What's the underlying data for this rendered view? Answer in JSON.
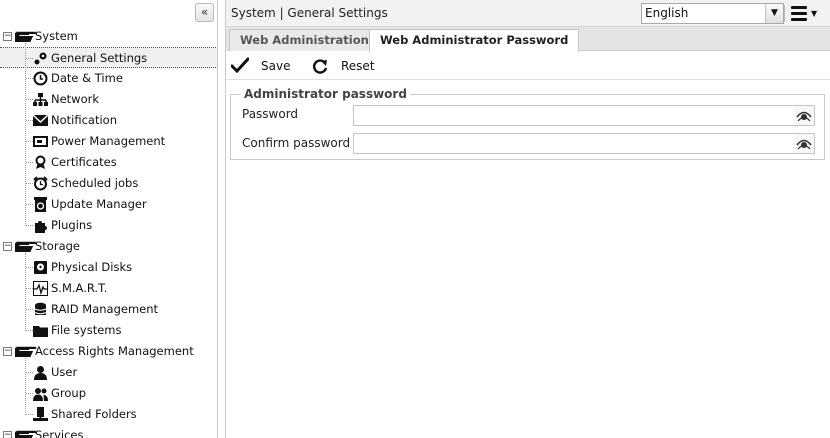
{
  "nav": {
    "collapse_glyph": "«",
    "groups": [
      {
        "label": "System",
        "expanded": true,
        "children": [
          {
            "label": "General Settings",
            "icon": "gear-icon",
            "selected": true
          },
          {
            "label": "Date & Time",
            "icon": "clock-icon"
          },
          {
            "label": "Network",
            "icon": "network-icon"
          },
          {
            "label": "Notification",
            "icon": "envelope-icon"
          },
          {
            "label": "Power Management",
            "icon": "power-icon"
          },
          {
            "label": "Certificates",
            "icon": "certificate-icon"
          },
          {
            "label": "Scheduled jobs",
            "icon": "alarm-clock-icon"
          },
          {
            "label": "Update Manager",
            "icon": "update-icon"
          },
          {
            "label": "Plugins",
            "icon": "puzzle-icon"
          }
        ]
      },
      {
        "label": "Storage",
        "expanded": true,
        "children": [
          {
            "label": "Physical Disks",
            "icon": "disk-icon"
          },
          {
            "label": "S.M.A.R.T.",
            "icon": "heartbeat-icon"
          },
          {
            "label": "RAID Management",
            "icon": "database-icon"
          },
          {
            "label": "File systems",
            "icon": "folder-icon"
          }
        ]
      },
      {
        "label": "Access Rights Management",
        "expanded": true,
        "children": [
          {
            "label": "User",
            "icon": "user-icon"
          },
          {
            "label": "Group",
            "icon": "group-icon"
          },
          {
            "label": "Shared Folders",
            "icon": "shared-folder-icon"
          }
        ]
      },
      {
        "label": "Services",
        "expanded": true,
        "children": []
      }
    ]
  },
  "header": {
    "breadcrumb": "System | General Settings",
    "language": "English"
  },
  "tabs": [
    {
      "label": "Web Administration",
      "active": false
    },
    {
      "label": "Web Administrator Password",
      "active": true
    }
  ],
  "toolbar": {
    "save_label": "Save",
    "reset_label": "Reset"
  },
  "form": {
    "legend": "Administrator password",
    "password_label": "Password",
    "password_value": "",
    "confirm_label": "Confirm password",
    "confirm_value": ""
  }
}
